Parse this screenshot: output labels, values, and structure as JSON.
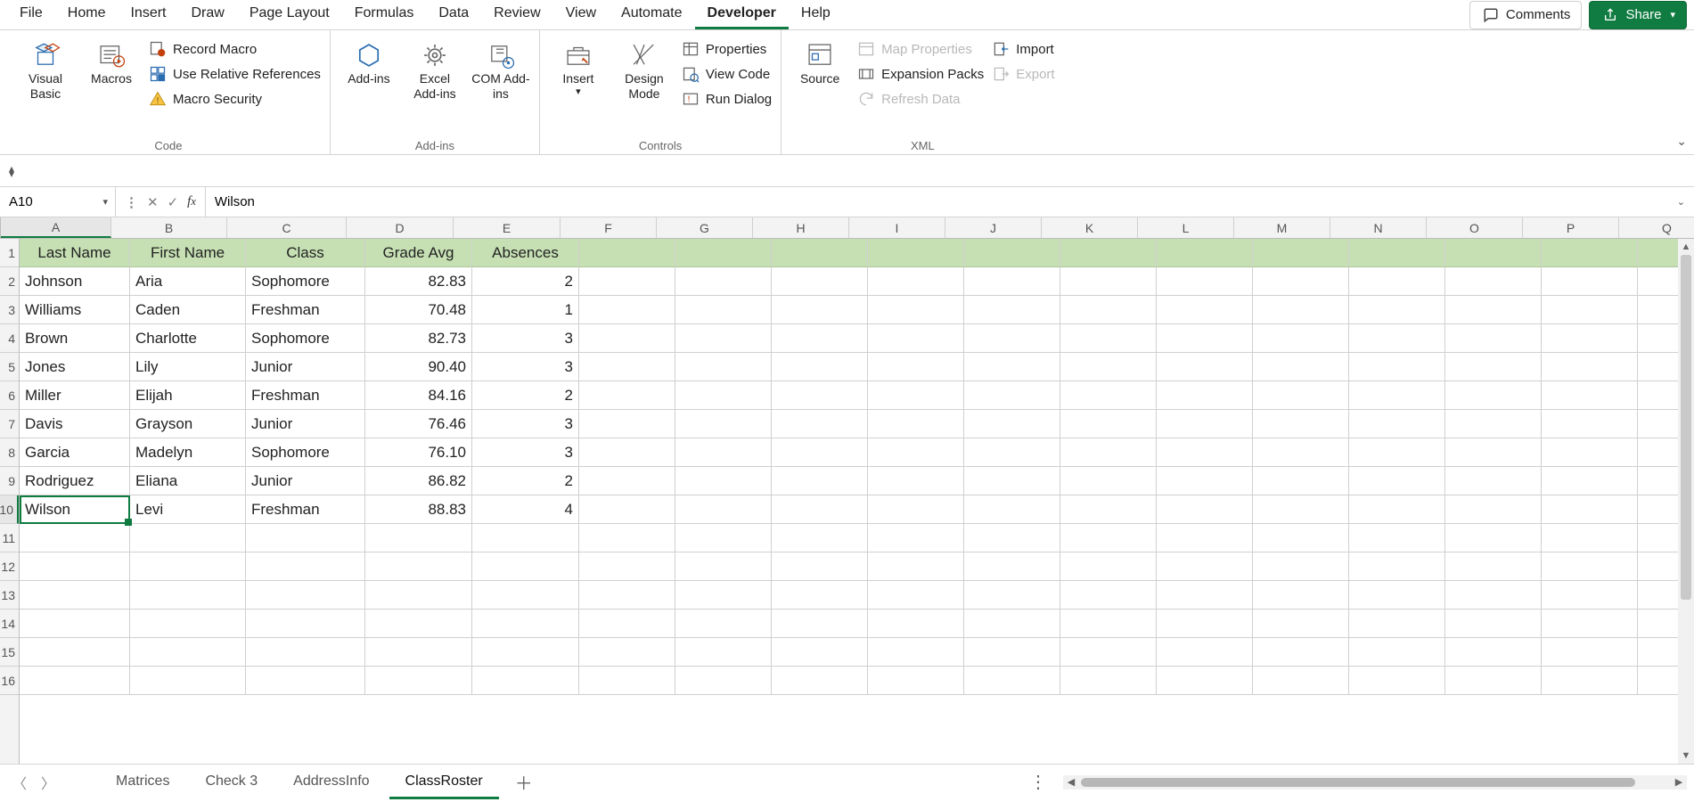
{
  "menu": {
    "items": [
      "File",
      "Home",
      "Insert",
      "Draw",
      "Page Layout",
      "Formulas",
      "Data",
      "Review",
      "View",
      "Automate",
      "Developer",
      "Help"
    ],
    "active": "Developer",
    "comments": "Comments",
    "share": "Share"
  },
  "ribbon": {
    "groups": {
      "code": {
        "label": "Code",
        "visual_basic": "Visual Basic",
        "macros": "Macros",
        "record_macro": "Record Macro",
        "use_relative": "Use Relative References",
        "macro_security": "Macro Security"
      },
      "addins": {
        "label": "Add-ins",
        "addins": "Add-ins",
        "excel_addins": "Excel Add-ins",
        "com_addins": "COM Add-ins"
      },
      "controls": {
        "label": "Controls",
        "insert": "Insert",
        "design_mode": "Design Mode",
        "properties": "Properties",
        "view_code": "View Code",
        "run_dialog": "Run Dialog"
      },
      "xml": {
        "label": "XML",
        "source": "Source",
        "map_properties": "Map Properties",
        "expansion_packs": "Expansion Packs",
        "refresh_data": "Refresh Data",
        "import": "Import",
        "export": "Export"
      }
    }
  },
  "formula_bar": {
    "namebox": "A10",
    "formula": "Wilson"
  },
  "columns": [
    "A",
    "B",
    "C",
    "D",
    "E",
    "F",
    "G",
    "H",
    "I",
    "J",
    "K",
    "L",
    "M",
    "N",
    "O",
    "P",
    "Q"
  ],
  "active_column": "A",
  "row_numbers": [
    "1",
    "2",
    "3",
    "4",
    "5",
    "6",
    "7",
    "8",
    "9",
    "10",
    "11",
    "12",
    "13",
    "14",
    "15",
    "16"
  ],
  "active_row": 10,
  "table": {
    "headers": [
      "Last Name",
      "First Name",
      "Class",
      "Grade Avg",
      "Absences"
    ],
    "rows": [
      {
        "last": "Johnson",
        "first": "Aria",
        "class": "Sophomore",
        "grade": "82.83",
        "abs": "2"
      },
      {
        "last": "Williams",
        "first": "Caden",
        "class": "Freshman",
        "grade": "70.48",
        "abs": "1"
      },
      {
        "last": "Brown",
        "first": "Charlotte",
        "class": "Sophomore",
        "grade": "82.73",
        "abs": "3"
      },
      {
        "last": "Jones",
        "first": "Lily",
        "class": "Junior",
        "grade": "90.40",
        "abs": "3"
      },
      {
        "last": "Miller",
        "first": "Elijah",
        "class": "Freshman",
        "grade": "84.16",
        "abs": "2"
      },
      {
        "last": "Davis",
        "first": "Grayson",
        "class": "Junior",
        "grade": "76.46",
        "abs": "3"
      },
      {
        "last": "Garcia",
        "first": "Madelyn",
        "class": "Sophomore",
        "grade": "76.10",
        "abs": "3"
      },
      {
        "last": "Rodriguez",
        "first": "Eliana",
        "class": "Junior",
        "grade": "86.82",
        "abs": "2"
      },
      {
        "last": "Wilson",
        "first": "Levi",
        "class": "Freshman",
        "grade": "88.83",
        "abs": "4"
      }
    ]
  },
  "sheets": {
    "tabs": [
      "Matrices",
      "Check 3",
      "AddressInfo",
      "ClassRoster"
    ],
    "active": "ClassRoster"
  }
}
